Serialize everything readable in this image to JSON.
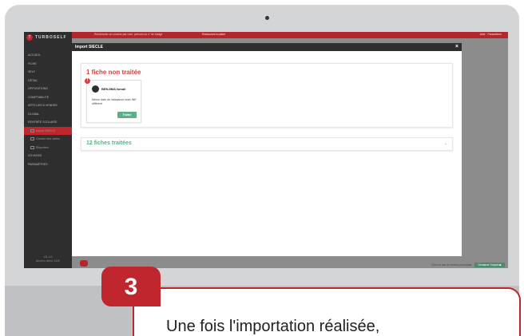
{
  "app": {
    "brand": "TURBOSELF",
    "version_line1": "v11.4.0",
    "version_line2": "Numéro client: 4120",
    "accent_color": "#c0262d",
    "green_color": "#5bb08a"
  },
  "topbar": {
    "search_text": "Rechercher un convive par nom, prénom ou n° de badge",
    "warning_text": "Restaurant scolaire",
    "right_text": "Aide  ·  Paramètres"
  },
  "sidebar": {
    "items": [
      {
        "label": "ACCUEIL"
      },
      {
        "label": "FICHE"
      },
      {
        "label": "SELF"
      },
      {
        "label": "DÉTAIL"
      },
      {
        "label": "OPPOSITIONS"
      },
      {
        "label": "COMPTABILITÉ"
      },
      {
        "label": "ARTICLES À VENDRE"
      },
      {
        "label": "GLOBAL"
      },
      {
        "label": "RENTRÉE SCOLAIRE"
      },
      {
        "label": "Import SIECLE"
      },
      {
        "label": "Gestion des cartes"
      },
      {
        "label": "Étiquettes"
      },
      {
        "label": "VOYAGES"
      },
      {
        "label": "PARAMÈTRES"
      }
    ]
  },
  "modal": {
    "title": "Import SIECLE",
    "close_icon": "×",
    "untreated_title": "1 fiche   non traitée",
    "card": {
      "alert": "!",
      "name": "BENJIMA Ismail",
      "issue": "Même date de naissance mais INE différent",
      "button": "Traiter"
    },
    "treated_title": "12 fiches traitées",
    "chevron": "⌄"
  },
  "footer_bar": {
    "text": "Écrit en cas de rentrée prochaine",
    "button": "Démarrer l'import ▶"
  },
  "callout": {
    "step": "3",
    "text": "Une fois l'importation réalisée,"
  }
}
